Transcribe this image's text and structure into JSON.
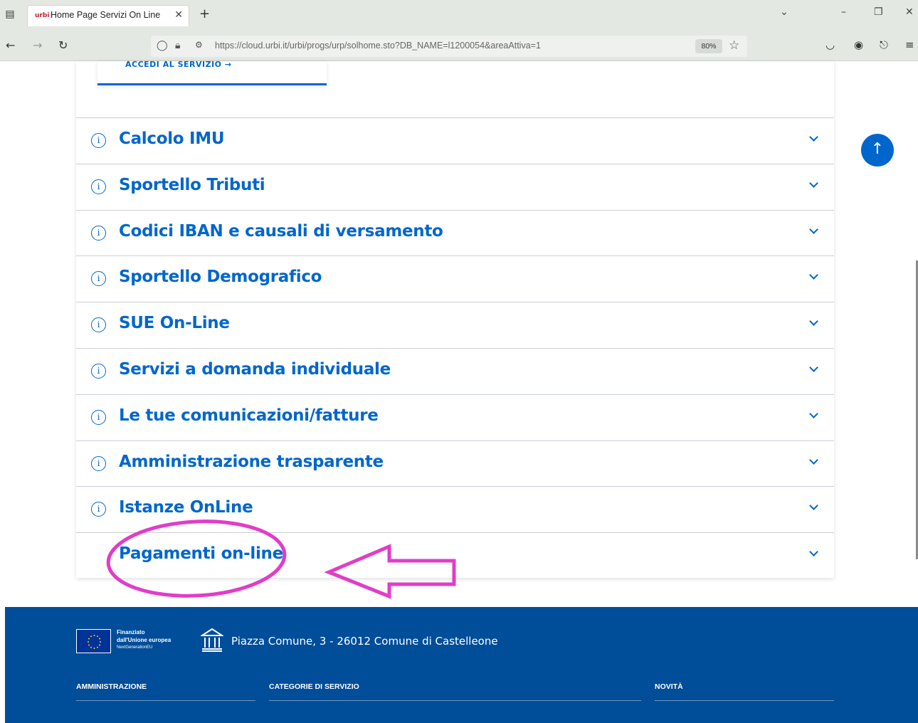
{
  "browser": {
    "tab_title": "Home Page Servizi On Line",
    "tab_favicon_text": "urbi",
    "url": "https://cloud.urbi.it/urbi/progs/urp/solhome.sto?DB_NAME=l1200054&areaAttiva=1",
    "zoom": "80%"
  },
  "page": {
    "service_link": "ACCEDI AL SERVIZIO",
    "accordion": [
      {
        "title": "Calcolo IMU",
        "has_info": true
      },
      {
        "title": "Sportello Tributi",
        "has_info": true
      },
      {
        "title": "Codici IBAN e causali di versamento",
        "has_info": true
      },
      {
        "title": "Sportello Demografico",
        "has_info": true
      },
      {
        "title": "SUE On-Line",
        "has_info": true
      },
      {
        "title": "Servizi a domanda individuale",
        "has_info": true
      },
      {
        "title": "Le tue comunicazioni/fatture",
        "has_info": true
      },
      {
        "title": "Amministrazione trasparente",
        "has_info": true
      },
      {
        "title": "Istanze OnLine",
        "has_info": true
      },
      {
        "title": "Pagamenti on-line",
        "has_info": false
      }
    ],
    "annotation_color": "#e23cc8"
  },
  "footer": {
    "eu_line1": "Finanziato",
    "eu_line2": "dall'Unione europea",
    "eu_line3": "NextGenerationEU",
    "address": "Piazza Comune, 3 - 26012 Comune di Castelleone",
    "columns": [
      "AMMINISTRAZIONE",
      "CATEGORIE DI SERVIZIO",
      "NOVITÀ"
    ],
    "background": "#004d99"
  }
}
